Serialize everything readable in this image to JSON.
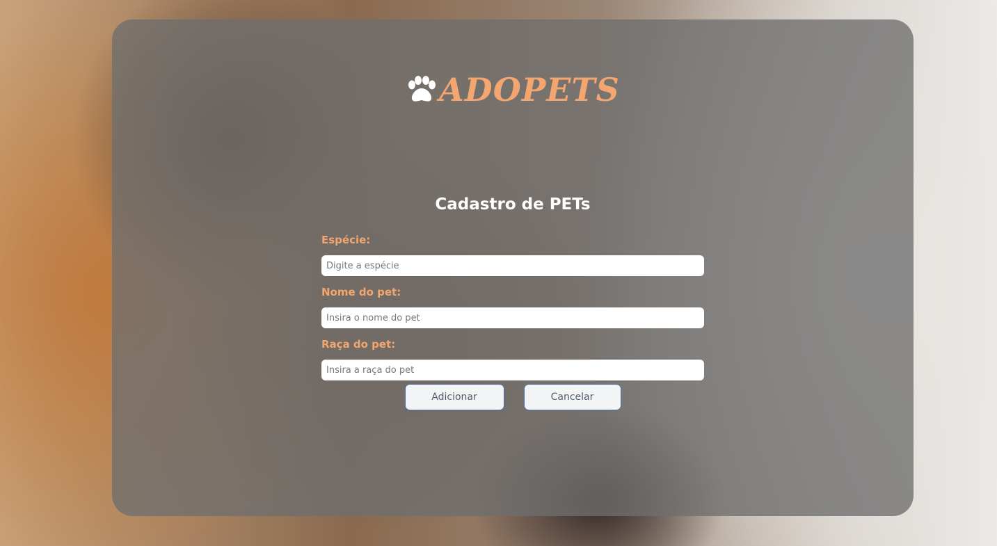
{
  "brand": {
    "name": "ADOPETS",
    "logo_icon": "paw-icon",
    "color": "#f3a66f"
  },
  "form": {
    "title": "Cadastro de PETs",
    "fields": [
      {
        "label": "Espécie:",
        "placeholder": "Digite a espécie",
        "value": ""
      },
      {
        "label": "Nome do pet:",
        "placeholder": "Insira o nome do pet",
        "value": ""
      },
      {
        "label": "Raça do pet:",
        "placeholder": "Insira a raça do pet",
        "value": ""
      }
    ]
  },
  "actions": {
    "add_label": "Adicionar",
    "cancel_label": "Cancelar"
  },
  "colors": {
    "label": "#f3a66f",
    "title": "#ffffff",
    "button_border": "#4a6fa5",
    "button_text": "#4e5d6c"
  }
}
